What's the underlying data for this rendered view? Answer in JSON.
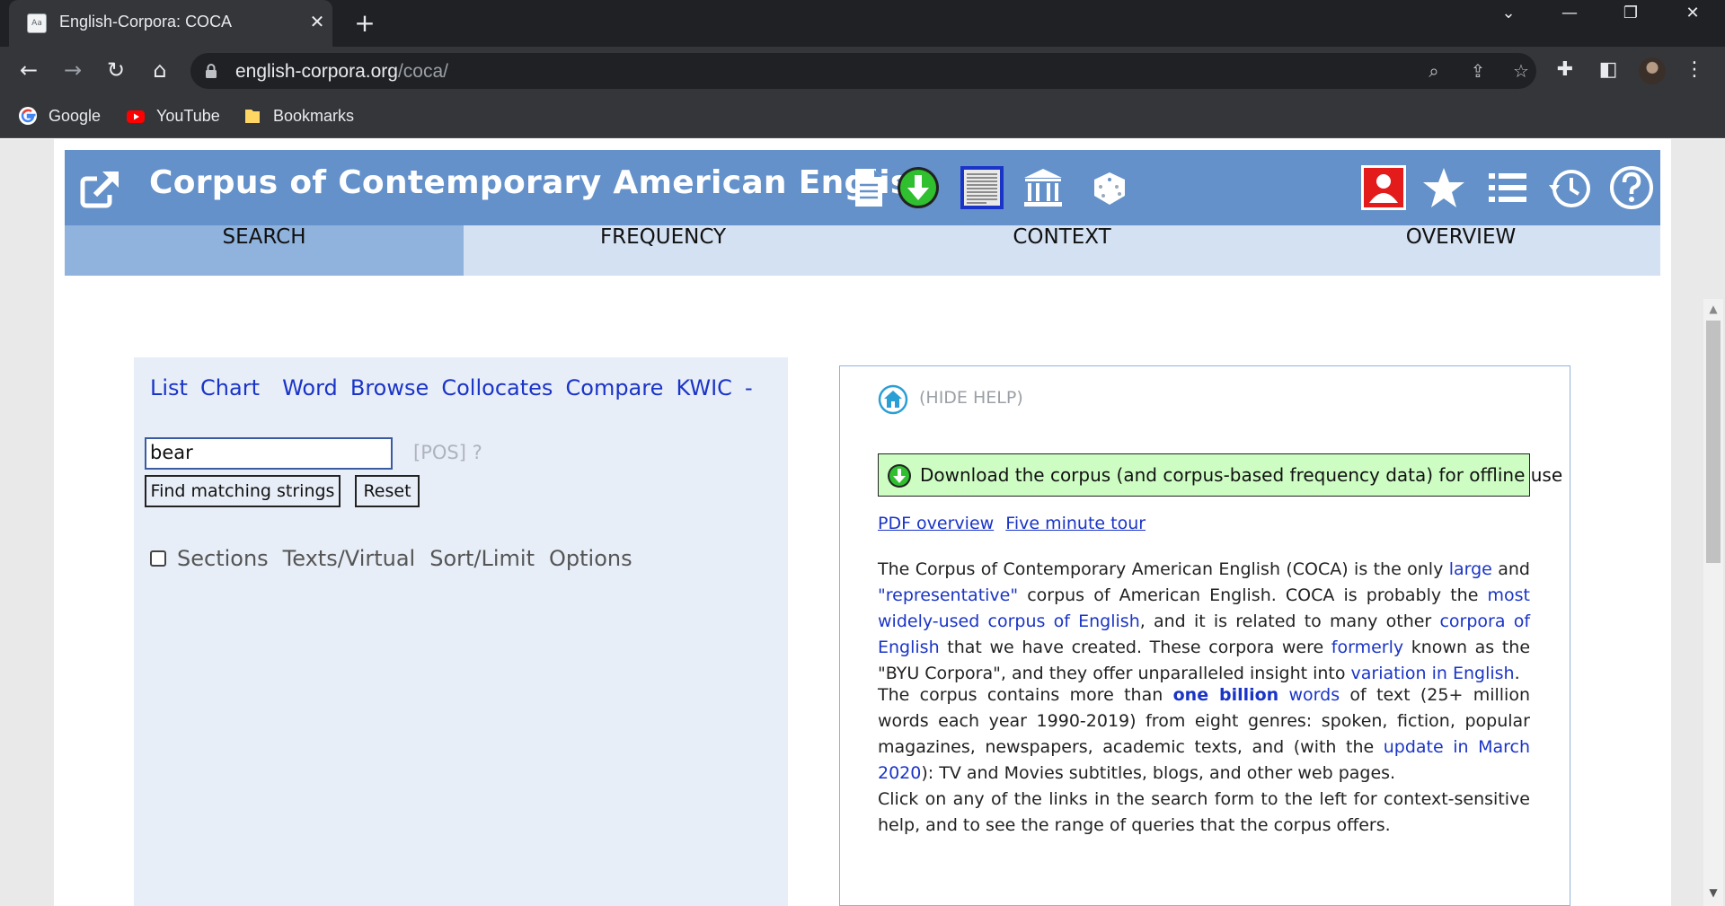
{
  "browser": {
    "tab_title": "English-Corpora: COCA",
    "tab_favicon_text": "Aa",
    "url_domain": "english-corpora.org",
    "url_path": "/coca/",
    "bookmarks": [
      {
        "label": "Google",
        "icon": "google-icon"
      },
      {
        "label": "YouTube",
        "icon": "youtube-icon"
      },
      {
        "label": "Bookmarks",
        "icon": "folder-icon"
      }
    ]
  },
  "header": {
    "title": "Corpus of Contemporary American English",
    "colors": {
      "banner": "#6491c9",
      "nav": "#d3e1f3",
      "nav_active": "#8fb3dd"
    }
  },
  "nav": {
    "tabs": [
      "SEARCH",
      "FREQUENCY",
      "CONTEXT",
      "OVERVIEW"
    ],
    "active": "SEARCH"
  },
  "search": {
    "links": [
      "List",
      "Chart",
      "Word",
      "Browse",
      "Collocates",
      "Compare",
      "KWIC",
      "-"
    ],
    "query": "bear",
    "pos_hint": "[POS] ?",
    "find_button": "Find matching strings",
    "reset_button": "Reset",
    "options": [
      "Sections",
      "Texts/Virtual",
      "Sort/Limit",
      "Options"
    ],
    "sections_checked": false
  },
  "help": {
    "hide_help": "(HIDE HELP)",
    "download_text": "Download the corpus (and corpus-based frequency data) for offline use",
    "links": [
      "PDF overview",
      "Five minute tour"
    ],
    "p1": [
      {
        "t": "The Corpus of Contemporary American English (COCA) is the only "
      },
      {
        "t": "large",
        "link": true
      },
      {
        "t": " and "
      },
      {
        "t": "\"representative\"",
        "link": true
      },
      {
        "t": " corpus of American English. COCA is probably the "
      },
      {
        "t": "most widely-used corpus of English",
        "link": true
      },
      {
        "t": ", and it is related to many other "
      },
      {
        "t": "corpora of English",
        "link": true
      },
      {
        "t": " that we have created. These corpora were "
      },
      {
        "t": "formerly",
        "link": true
      },
      {
        "t": " known as the \"BYU Corpora\", and they offer unparalleled insight into "
      },
      {
        "t": "variation in English",
        "link": true
      },
      {
        "t": "."
      }
    ],
    "p2": [
      {
        "t": "The corpus contains more than "
      },
      {
        "t": "one billion",
        "link": true,
        "bold": true
      },
      {
        "t": " "
      },
      {
        "t": "words",
        "link": true
      },
      {
        "t": " of text (25+ million words each year 1990-2019) from eight genres: spoken, fiction, popular magazines, newspapers, academic texts, and (with the "
      },
      {
        "t": "update in March 2020",
        "link": true
      },
      {
        "t": "): TV and Movies subtitles, blogs, and other web pages."
      }
    ],
    "p3": "Click on any of the links in the search form to the left for context-sensitive help, and to see the range of queries that the corpus offers."
  }
}
